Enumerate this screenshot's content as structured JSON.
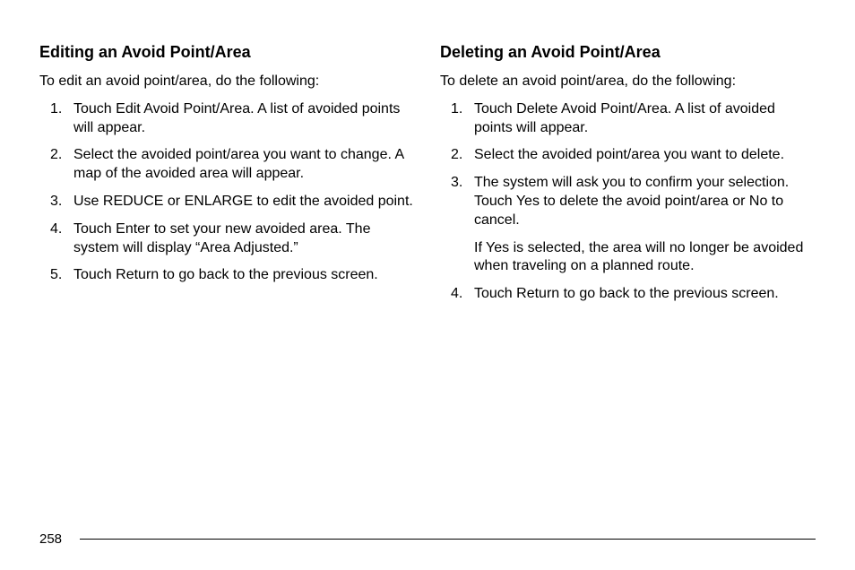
{
  "left": {
    "heading": "Editing an Avoid Point/Area",
    "intro": "To edit an avoid point/area, do the following:",
    "steps": [
      {
        "num": "1.",
        "text": "Touch Edit Avoid Point/Area. A list of avoided points will appear."
      },
      {
        "num": "2.",
        "text": "Select the avoided point/area you want to change. A map of the avoided area will appear."
      },
      {
        "num": "3.",
        "text": "Use REDUCE or ENLARGE to edit the avoided point."
      },
      {
        "num": "4.",
        "text": "Touch Enter to set your new avoided area. The system will display “Area Adjusted.”"
      },
      {
        "num": "5.",
        "text": "Touch Return to go back to the previous screen."
      }
    ]
  },
  "right": {
    "heading": "Deleting an Avoid Point/Area",
    "intro": "To delete an avoid point/area, do the following:",
    "steps": [
      {
        "num": "1.",
        "text": "Touch Delete Avoid Point/Area. A list of avoided points will appear."
      },
      {
        "num": "2.",
        "text": "Select the avoided point/area you want to delete."
      },
      {
        "num": "3.",
        "text": "The system will ask you to confirm your selection. Touch Yes to delete the avoid point/area or No to cancel.",
        "extra": "If Yes is selected, the area will no longer be avoided when traveling on a planned route."
      },
      {
        "num": "4.",
        "text": "Touch Return to go back to the previous screen."
      }
    ]
  },
  "page_number": "258"
}
